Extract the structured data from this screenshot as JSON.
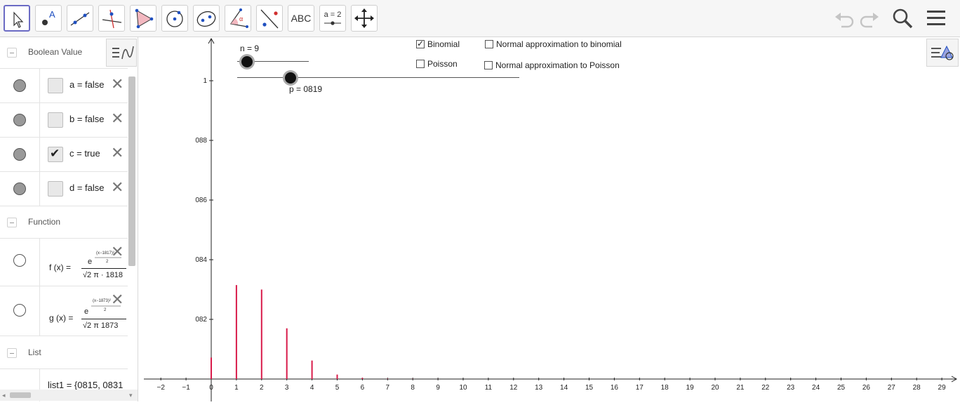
{
  "toolbar": {
    "tools": [
      {
        "name": "move-tool-icon",
        "active": true
      },
      {
        "name": "point-tool-icon"
      },
      {
        "name": "line-tool-icon"
      },
      {
        "name": "perpendicular-line-tool-icon"
      },
      {
        "name": "polygon-tool-icon"
      },
      {
        "name": "circle-tool-icon"
      },
      {
        "name": "ellipse-tool-icon"
      },
      {
        "name": "angle-tool-icon"
      },
      {
        "name": "reflect-tool-icon"
      },
      {
        "name": "text-tool-icon",
        "label": "ABC"
      },
      {
        "name": "slider-tool-icon",
        "label": "a = 2"
      },
      {
        "name": "move-graphics-view-tool-icon"
      }
    ],
    "right": [
      "undo-icon",
      "redo-icon",
      "search-icon",
      "menu-icon"
    ]
  },
  "algebra": {
    "groups": {
      "boolean": "Boolean Value",
      "function": "Function",
      "list": "List"
    },
    "booleans": [
      {
        "text": "a = false",
        "checked": false
      },
      {
        "text": "b = false",
        "checked": false
      },
      {
        "text": "c = true",
        "checked": true
      },
      {
        "text": "d = false",
        "checked": false
      }
    ],
    "functions": [
      {
        "lhs": "f (x)  =",
        "numerator": "e",
        "denominator": "√2 π · 1818"
      },
      {
        "lhs": "g (x)  =",
        "numerator": "e",
        "denominator": "√2 π 1873"
      }
    ],
    "list1": "list1 = {0815, 0831"
  },
  "graphics": {
    "sliders": {
      "n_label": "n = 9",
      "p_label": "p = 0819"
    },
    "checkboxes": [
      {
        "label": "Binomial",
        "checked": true
      },
      {
        "label": "Poisson",
        "checked": false
      },
      {
        "label": "Normal approximation to binomial",
        "checked": false
      },
      {
        "label": "Normal approximation to Poisson",
        "checked": false
      }
    ],
    "colors": {
      "bars": "#d81b4a",
      "axis": "#222222"
    }
  },
  "chart_data": {
    "type": "bar",
    "x_ticks": [
      "−2",
      "−1",
      "0",
      "1",
      "2",
      "3",
      "4",
      "5",
      "6",
      "7",
      "8",
      "9",
      "10",
      "11",
      "12",
      "13",
      "14",
      "15",
      "16",
      "17",
      "18",
      "19",
      "20",
      "21",
      "22",
      "23",
      "24",
      "25",
      "26",
      "27",
      "28",
      "29"
    ],
    "y_ticks": [
      "082",
      "084",
      "086",
      "088",
      "1"
    ],
    "x": [
      0,
      1,
      2,
      3,
      4,
      5,
      6,
      7,
      8,
      9
    ],
    "values": [
      0.072,
      0.315,
      0.3,
      0.17,
      0.062,
      0.015,
      0.004,
      0.001,
      0.0005,
      0.0002
    ],
    "xlim": [
      -2,
      29
    ],
    "ylim": [
      0,
      1
    ],
    "grid": false
  }
}
